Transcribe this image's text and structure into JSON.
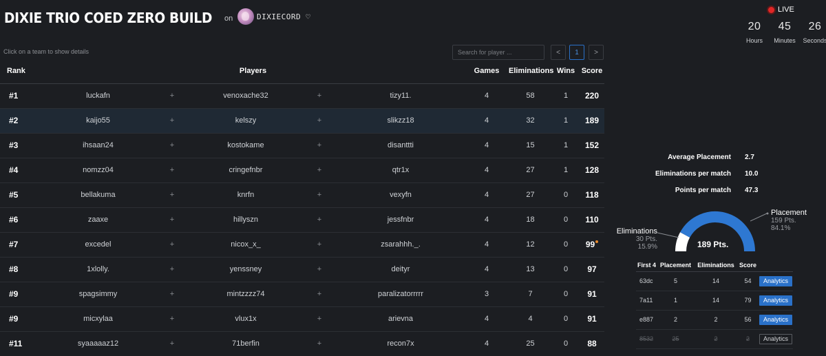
{
  "header": {
    "title": "DIXIE TRIO COED ZERO BUILD",
    "on_label": "on",
    "server_name": "DIXIECORD ♡"
  },
  "live": {
    "label": "LIVE",
    "hours": "20",
    "hours_label": "Hours",
    "minutes": "45",
    "minutes_label": "Minutes",
    "seconds": "26",
    "seconds_label": "Seconds"
  },
  "hint": "Click on a team to show details",
  "search": {
    "placeholder": "Search for player ..."
  },
  "pagination": {
    "prev": "<",
    "page": "1",
    "next": ">"
  },
  "table": {
    "headers": {
      "rank": "Rank",
      "players": "Players",
      "games": "Games",
      "eliminations": "Eliminations",
      "wins": "Wins",
      "score": "Score"
    },
    "plus": "+",
    "rows": [
      {
        "rank": "#1",
        "p1": "luckafn",
        "p2": "venoxache32",
        "p3": "tizy11.",
        "games": "4",
        "elims": "58",
        "wins": "1",
        "score": "220"
      },
      {
        "rank": "#2",
        "p1": "kaijo55",
        "p2": "kelszy",
        "p3": "slikzz18",
        "games": "4",
        "elims": "32",
        "wins": "1",
        "score": "189"
      },
      {
        "rank": "#3",
        "p1": "ihsaan24",
        "p2": "kostokame",
        "p3": "disanttti",
        "games": "4",
        "elims": "15",
        "wins": "1",
        "score": "152"
      },
      {
        "rank": "#4",
        "p1": "nomzz04",
        "p2": "cringefnbr",
        "p3": "qtr1x",
        "games": "4",
        "elims": "27",
        "wins": "1",
        "score": "128"
      },
      {
        "rank": "#5",
        "p1": "bellakuma",
        "p2": "knrfn",
        "p3": "vexyfn",
        "games": "4",
        "elims": "27",
        "wins": "0",
        "score": "118"
      },
      {
        "rank": "#6",
        "p1": "zaaxe",
        "p2": "hillyszn",
        "p3": "jessfnbr",
        "games": "4",
        "elims": "18",
        "wins": "0",
        "score": "110"
      },
      {
        "rank": "#7",
        "p1": "excedel",
        "p2": "nicox_x_",
        "p3": "zsarahhh._.",
        "games": "4",
        "elims": "12",
        "wins": "0",
        "score": "99"
      },
      {
        "rank": "#8",
        "p1": "1xlolly.",
        "p2": "yenssney",
        "p3": "deityr",
        "games": "4",
        "elims": "13",
        "wins": "0",
        "score": "97"
      },
      {
        "rank": "#9",
        "p1": "spagsimmy",
        "p2": "mintzzzz74",
        "p3": "paralizatorrrrr",
        "games": "3",
        "elims": "7",
        "wins": "0",
        "score": "91"
      },
      {
        "rank": "#9",
        "p1": "micxylaa",
        "p2": "vlux1x",
        "p3": "arievna",
        "games": "4",
        "elims": "4",
        "wins": "0",
        "score": "91"
      },
      {
        "rank": "#11",
        "p1": "syaaaaaz12",
        "p2": "71berfin",
        "p3": "recon7x",
        "games": "4",
        "elims": "25",
        "wins": "0",
        "score": "88"
      }
    ]
  },
  "details": {
    "avg_placement_label": "Average Placement",
    "avg_placement": "2.7",
    "elims_per_match_label": "Eliminations per match",
    "elims_per_match": "10.0",
    "points_per_match_label": "Points per match",
    "points_per_match": "47.3",
    "total_points": "189 Pts.",
    "placement_title": "Placement",
    "placement_pts": "159 Pts.",
    "placement_pct": "84.1%",
    "placement_fraction": 0.841,
    "elims_title": "Eliminations",
    "elims_pts": "30 Pts.",
    "elims_pct": "15.9%",
    "colors": {
      "placement": "#2e78d2",
      "eliminations": "#ffffff",
      "accent": "#2a71c9"
    },
    "first4": {
      "headers": [
        "First 4",
        "Placement",
        "Eliminations",
        "Score",
        ""
      ],
      "button_label": "Analytics",
      "rows": [
        {
          "id": "63dc",
          "placement": "5",
          "elims": "14",
          "score": "54"
        },
        {
          "id": "7a11",
          "placement": "1",
          "elims": "14",
          "score": "79"
        },
        {
          "id": "e887",
          "placement": "2",
          "elims": "2",
          "score": "56"
        },
        {
          "id": "8532",
          "placement": "25",
          "elims": "2",
          "score": "2"
        }
      ]
    }
  }
}
